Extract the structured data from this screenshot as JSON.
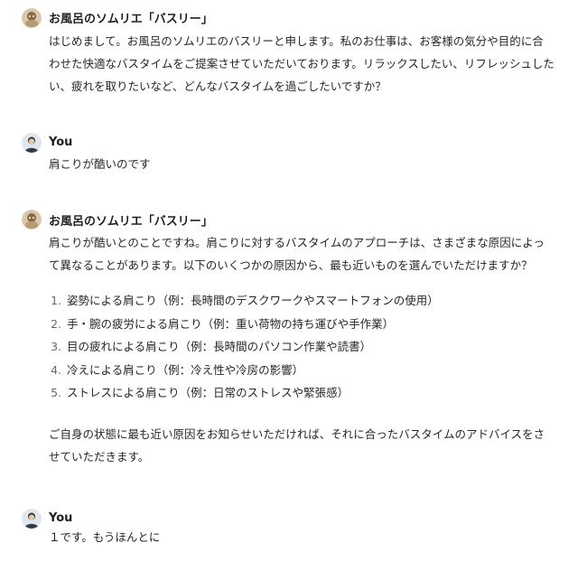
{
  "messages": [
    {
      "author": "お風呂のソムリエ「バスリー」",
      "avatar_icon": "bathtub-sommelier-avatar",
      "paragraphs": [
        "はじめまして。お風呂のソムリエのバスリーと申します。私のお仕事は、お客様の気分や目的に合わせた快適なバスタイムをご提案させていただいております。リラックスしたい、リフレッシュしたい、疲れを取りたいなど、どんなバスタイムを過ごしたいですか？"
      ]
    },
    {
      "author": "You",
      "avatar_icon": "user-avatar",
      "paragraphs": [
        "肩こりが酷いのです"
      ]
    },
    {
      "author": "お風呂のソムリエ「バスリー」",
      "avatar_icon": "bathtub-sommelier-avatar",
      "intro": "肩こりが酷いとのことですね。肩こりに対するバスタイムのアプローチは、さまざまな原因によって異なることがあります。以下のいくつかの原因から、最も近いものを選んでいただけますか？",
      "list": [
        {
          "num": "1.",
          "text": "姿勢による肩こり（例：長時間のデスクワークやスマートフォンの使用）"
        },
        {
          "num": "2.",
          "text": "手・腕の疲労による肩こり（例：重い荷物の持ち運びや手作業）"
        },
        {
          "num": "3.",
          "text": "目の疲れによる肩こり（例：長時間のパソコン作業や読書）"
        },
        {
          "num": "4.",
          "text": "冷えによる肩こり（例：冷え性や冷房の影響）"
        },
        {
          "num": "5.",
          "text": "ストレスによる肩こり（例：日常のストレスや緊張感）"
        }
      ],
      "outro": "ご自身の状態に最も近い原因をお知らせいただければ、それに合ったバスタイムのアドバイスをさせていただきます。"
    },
    {
      "author": "You",
      "avatar_icon": "user-avatar",
      "paragraphs": [
        "１です。もうほんとに"
      ]
    }
  ]
}
